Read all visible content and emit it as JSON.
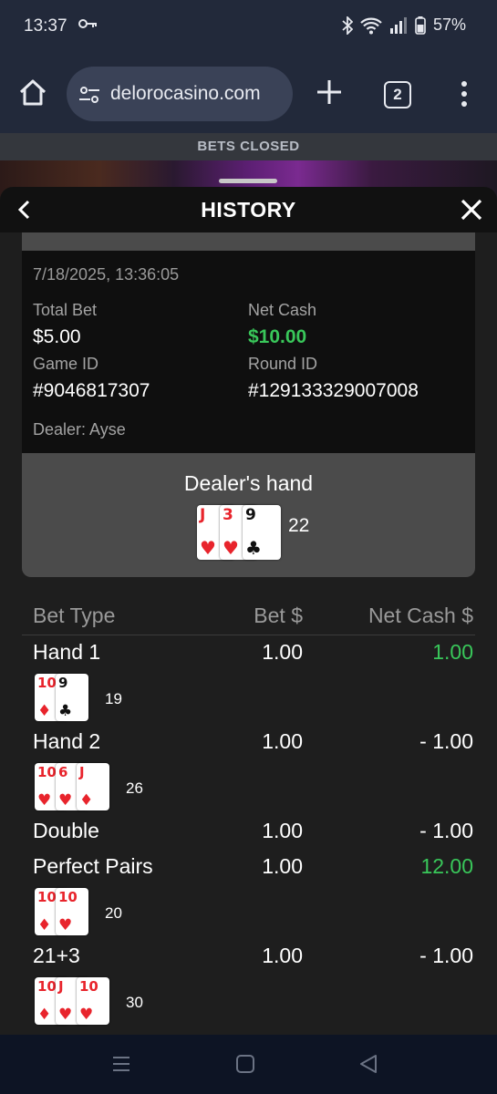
{
  "status_bar": {
    "time": "13:37",
    "key_icon": "key-icon",
    "battery": "57%"
  },
  "browser": {
    "url": "delorocasino.com",
    "tab_count": "2"
  },
  "game": {
    "banner": "BETS CLOSED"
  },
  "history": {
    "title": "HISTORY",
    "datetime": "7/18/2025, 13:36:05",
    "total_bet_label": "Total Bet",
    "total_bet": "$5.00",
    "net_cash_label": "Net Cash",
    "net_cash": "$10.00",
    "game_id_label": "Game ID",
    "game_id": "#9046817307",
    "round_id_label": "Round ID",
    "round_id": "#129133329007008",
    "dealer": "Dealer: Ayse",
    "dealer_hand_title": "Dealer's hand",
    "dealer_cards": [
      {
        "rank": "J",
        "suit": "♥",
        "color": "red"
      },
      {
        "rank": "3",
        "suit": "♥",
        "color": "red"
      },
      {
        "rank": "9",
        "suit": "♣",
        "color": "black"
      }
    ],
    "dealer_total": "22",
    "table_headers": {
      "bet_type": "Bet Type",
      "bet": "Bet $",
      "net_cash": "Net Cash $"
    },
    "bets": [
      {
        "name": "Hand 1",
        "bet": "1.00",
        "net": "1.00",
        "net_color": "green",
        "cards": [
          {
            "rank": "10",
            "suit": "♦",
            "color": "red"
          },
          {
            "rank": "9",
            "suit": "♣",
            "color": "black"
          }
        ],
        "total": "19"
      },
      {
        "name": "Hand 2",
        "bet": "1.00",
        "net": "- 1.00",
        "net_color": "white",
        "cards": [
          {
            "rank": "10",
            "suit": "♥",
            "color": "red"
          },
          {
            "rank": "6",
            "suit": "♥",
            "color": "red"
          },
          {
            "rank": "J",
            "suit": "♦",
            "color": "red"
          }
        ],
        "total": "26"
      },
      {
        "name": "Double",
        "bet": "1.00",
        "net": "- 1.00",
        "net_color": "white",
        "cards": [],
        "total": ""
      },
      {
        "name": "Perfect Pairs",
        "bet": "1.00",
        "net": "12.00",
        "net_color": "green",
        "cards": [
          {
            "rank": "10",
            "suit": "♦",
            "color": "red"
          },
          {
            "rank": "10",
            "suit": "♥",
            "color": "red"
          }
        ],
        "total": "20"
      },
      {
        "name": "21+3",
        "bet": "1.00",
        "net": "- 1.00",
        "net_color": "white",
        "cards": [
          {
            "rank": "10",
            "suit": "♦",
            "color": "red"
          },
          {
            "rank": "J",
            "suit": "♥",
            "color": "red"
          },
          {
            "rank": "10",
            "suit": "♥",
            "color": "red"
          }
        ],
        "total": "30"
      }
    ]
  },
  "colors": {
    "accent_green": "#39c75a",
    "sheet_bg": "#1e1e1e",
    "toolbar_bg": "#22293a"
  }
}
